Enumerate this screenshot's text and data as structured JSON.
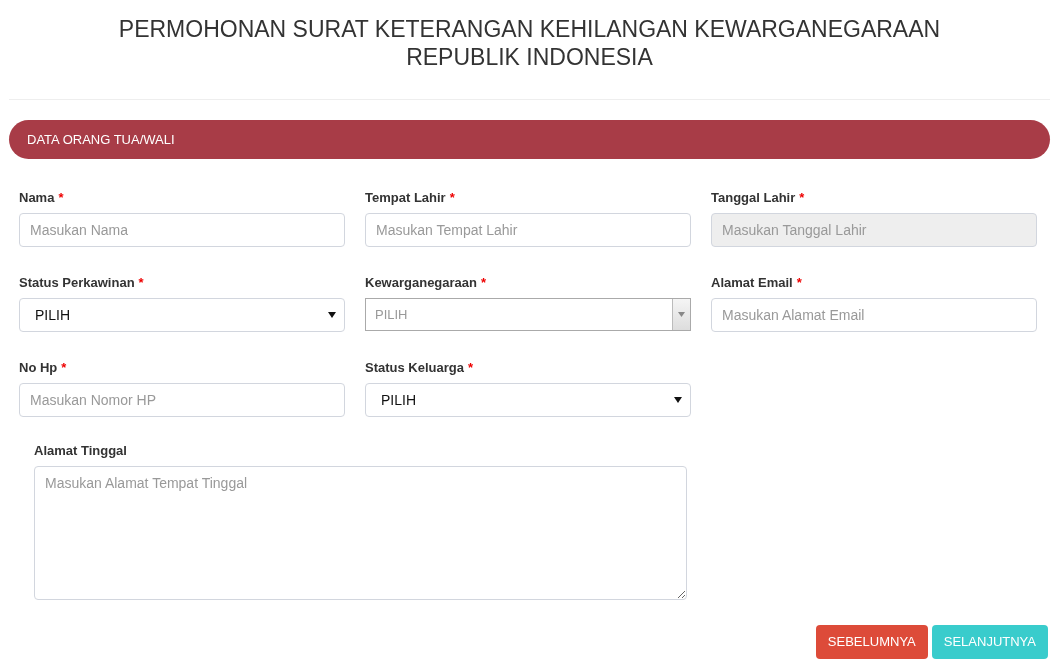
{
  "title_lines": [
    "PERMOHONAN SURAT KETERANGAN KEHILANGAN KEWARGANEGARAAN",
    "REPUBLIK INDONESIA"
  ],
  "section": {
    "title": "DATA ORANG TUA/WALI"
  },
  "fields": [
    {
      "kind": "text",
      "label": "Nama",
      "required_mark": "*",
      "placeholder": "Masukan Nama",
      "disabled": false
    },
    {
      "kind": "text",
      "label": "Tempat Lahir",
      "required_mark": "*",
      "placeholder": "Masukan Tempat Lahir",
      "disabled": false
    },
    {
      "kind": "text",
      "label": "Tanggal Lahir",
      "required_mark": "*",
      "placeholder": "Masukan Tanggal Lahir",
      "disabled": true
    },
    {
      "kind": "select",
      "label": "Status Perkawinan",
      "required_mark": "*",
      "value": "PILIH"
    },
    {
      "kind": "combo",
      "label": "Kewarganegaraan",
      "required_mark": "*",
      "placeholder": "PILIH"
    },
    {
      "kind": "text",
      "label": "Alamat Email",
      "required_mark": "*",
      "placeholder": "Masukan Alamat Email",
      "disabled": false
    },
    {
      "kind": "text",
      "label": "No Hp",
      "required_mark": "*",
      "placeholder": "Masukan Nomor HP",
      "disabled": false
    },
    {
      "kind": "select",
      "label": "Status Keluarga",
      "required_mark": "*",
      "value": "PILIH"
    }
  ],
  "address": {
    "label": "Alamat Tinggal",
    "placeholder": "Masukan Alamat Tempat Tinggal"
  },
  "buttons": [
    {
      "kind": "previous",
      "label": "SEBELUMNYA"
    },
    {
      "kind": "next",
      "label": "SELANJUTNYA"
    }
  ]
}
